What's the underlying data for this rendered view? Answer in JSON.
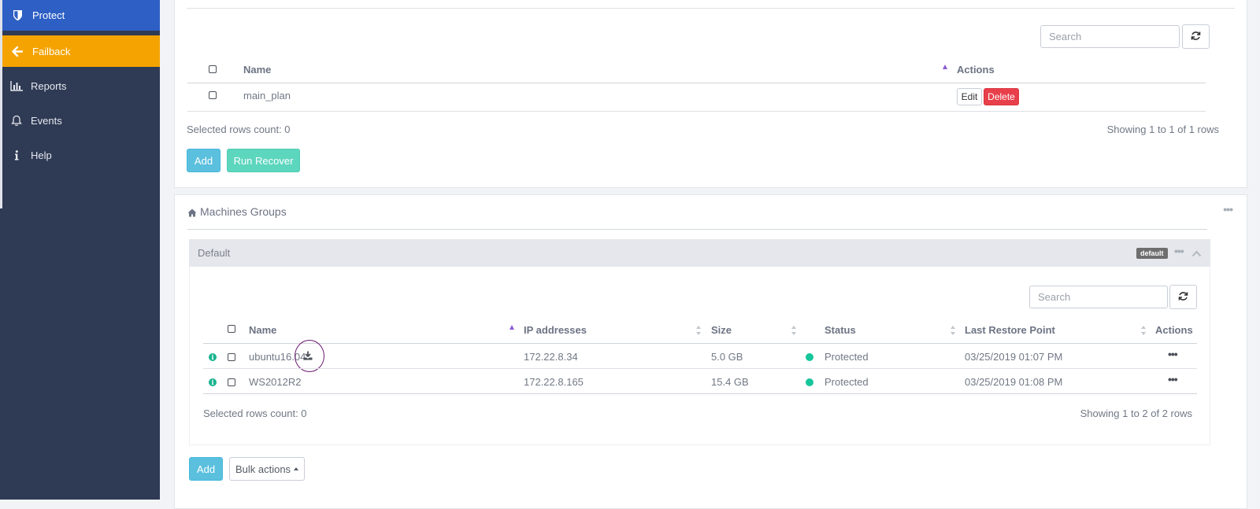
{
  "sidebar": {
    "items": [
      {
        "label": "Protect",
        "icon": "shield-icon"
      },
      {
        "label": "Failback",
        "icon": "arrow-left-icon"
      },
      {
        "label": "Reports",
        "icon": "bar-chart-icon"
      },
      {
        "label": "Events",
        "icon": "bell-icon"
      },
      {
        "label": "Help",
        "icon": "info-icon"
      }
    ]
  },
  "plans": {
    "search_placeholder": "Search",
    "columns": {
      "name": "Name",
      "actions": "Actions"
    },
    "rows": [
      {
        "name": "main_plan",
        "edit": "Edit",
        "delete": "Delete"
      }
    ],
    "selected_count": "Selected rows count: 0",
    "showing": "Showing 1 to 1 of 1 rows",
    "add_label": "Add",
    "run_recover_label": "Run Recover"
  },
  "machines_groups": {
    "title": "Machines Groups",
    "group": {
      "name": "Default",
      "badge": "default",
      "search_placeholder": "Search",
      "columns": {
        "name": "Name",
        "ip": "IP addresses",
        "size": "Size",
        "status": "Status",
        "last_restore": "Last Restore Point",
        "actions": "Actions"
      },
      "rows": [
        {
          "name": "ubuntu16.04",
          "ip": "172.22.8.34",
          "size": "5.0 GB",
          "status": "Protected",
          "last_restore": "03/25/2019 01:07 PM"
        },
        {
          "name": "WS2012R2",
          "ip": "172.22.8.165",
          "size": "15.4 GB",
          "status": "Protected",
          "last_restore": "03/25/2019 01:08 PM"
        }
      ],
      "selected_count": "Selected rows count: 0",
      "showing": "Showing 1 to 2 of 2 rows"
    },
    "add_label": "Add",
    "bulk_label": "Bulk actions"
  },
  "colors": {
    "sidebar_bg": "#2f3a54",
    "protect_bg": "#2d5fc4",
    "failback_bg": "#f4a300",
    "status_protected": "#16c69a",
    "delete_red": "#e8404a"
  }
}
